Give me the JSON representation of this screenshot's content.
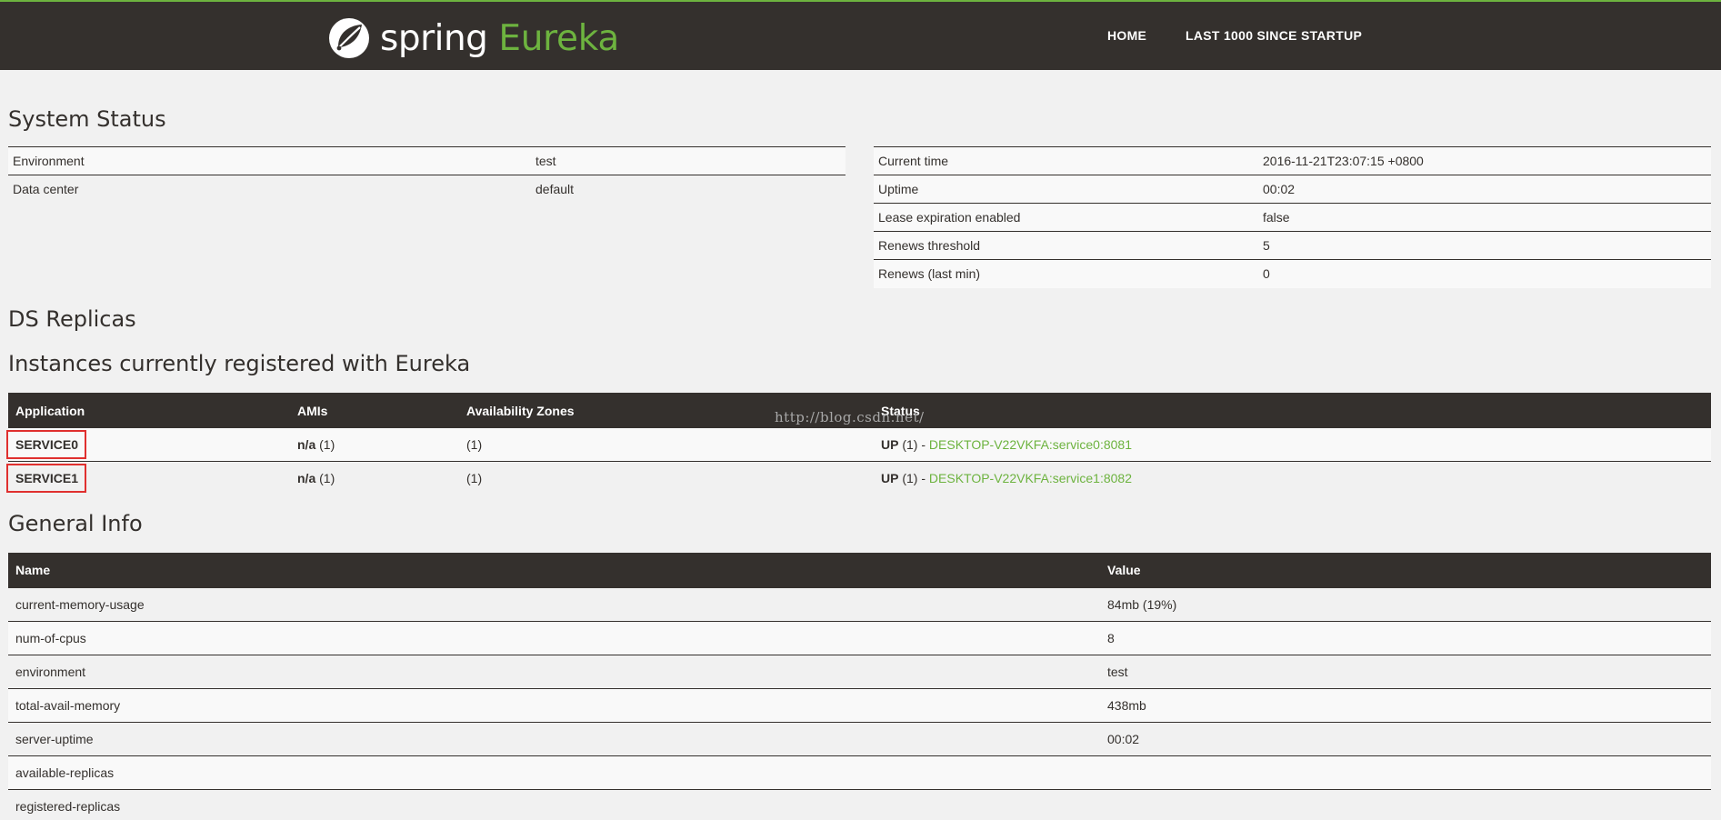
{
  "header": {
    "brand_spring": "spring",
    "brand_eureka": "Eureka",
    "nav": {
      "home": "HOME",
      "last": "LAST 1000 SINCE STARTUP"
    }
  },
  "colors": {
    "header_bg": "#34302d",
    "accent_green": "#6db33f",
    "highlight_red": "#e0302f",
    "page_bg": "#f1f1f1"
  },
  "sections": {
    "system_status": "System Status",
    "ds_replicas": "DS Replicas",
    "instances": "Instances currently registered with Eureka",
    "general_info": "General Info"
  },
  "system_left": [
    {
      "k": "Environment",
      "v": "test"
    },
    {
      "k": "Data center",
      "v": "default"
    }
  ],
  "system_right": [
    {
      "k": "Current time",
      "v": "2016-11-21T23:07:15 +0800"
    },
    {
      "k": "Uptime",
      "v": "00:02"
    },
    {
      "k": "Lease expiration enabled",
      "v": "false"
    },
    {
      "k": "Renews threshold",
      "v": "5"
    },
    {
      "k": "Renews (last min)",
      "v": "0"
    }
  ],
  "instances": {
    "headers": [
      "Application",
      "AMIs",
      "Availability Zones",
      "Status"
    ],
    "rows": [
      {
        "app": "SERVICE0",
        "ami_bold": "n/a",
        "ami_count": "(1)",
        "zones": "(1)",
        "status": "UP",
        "status_count": "(1) -",
        "link": "DESKTOP-V22VKFA:service0:8081"
      },
      {
        "app": "SERVICE1",
        "ami_bold": "n/a",
        "ami_count": "(1)",
        "zones": "(1)",
        "status": "UP",
        "status_count": "(1) -",
        "link": "DESKTOP-V22VKFA:service1:8082"
      }
    ]
  },
  "watermark": "http://blog.csdn.net/",
  "general_info": {
    "headers": [
      "Name",
      "Value"
    ],
    "rows": [
      {
        "k": "current-memory-usage",
        "v": "84mb (19%)"
      },
      {
        "k": "num-of-cpus",
        "v": "8"
      },
      {
        "k": "environment",
        "v": "test"
      },
      {
        "k": "total-avail-memory",
        "v": "438mb"
      },
      {
        "k": "server-uptime",
        "v": "00:02"
      },
      {
        "k": "available-replicas",
        "v": ""
      },
      {
        "k": "registered-replicas",
        "v": ""
      }
    ]
  }
}
